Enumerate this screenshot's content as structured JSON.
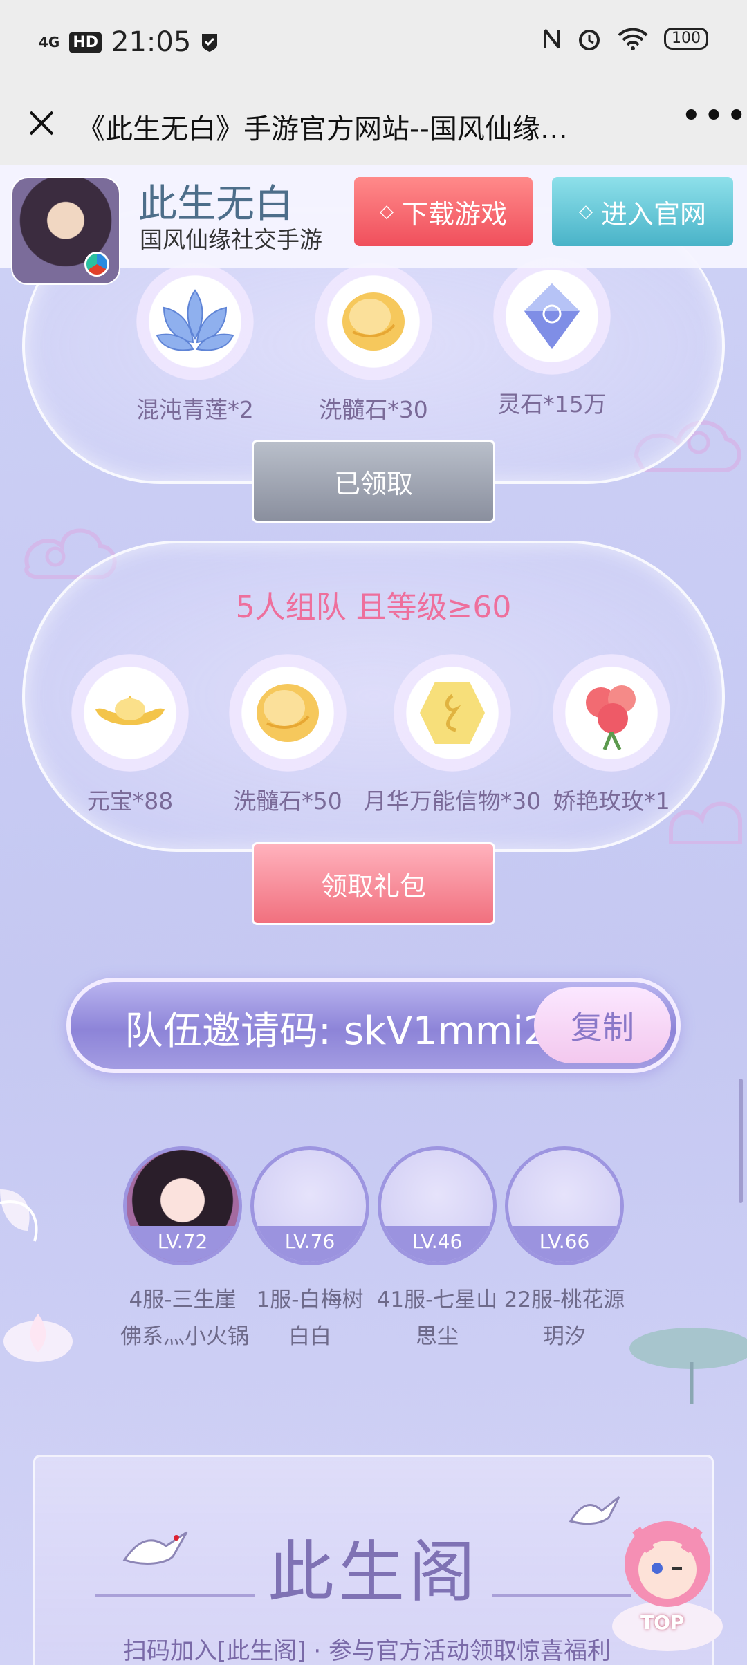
{
  "status_bar": {
    "network": "4G",
    "hd": "HD",
    "time": "21:05",
    "battery": "100"
  },
  "title_bar": {
    "title": "《此生无白》手游官方网站--国风仙缘…"
  },
  "app_banner": {
    "name": "此生无白",
    "subtitle": "国风仙缘社交手游",
    "download_label": "下载游戏",
    "official_label": "进入官网",
    "download_color": "#f04f5c",
    "official_color": "#49b3c8"
  },
  "panel1": {
    "items": [
      {
        "label": "混沌青莲*2",
        "icon": "lotus-icon"
      },
      {
        "label": "洗髓石*30",
        "icon": "gold-stone-icon"
      },
      {
        "label": "灵石*15万",
        "icon": "crystal-icon"
      }
    ],
    "button_label": "已领取"
  },
  "panel2": {
    "title": "5人组队 且等级≥60",
    "items": [
      {
        "label": "元宝*88",
        "icon": "gold-ingot-icon"
      },
      {
        "label": "洗髓石*50",
        "icon": "gold-stone-icon"
      },
      {
        "label": "月华万能信物*30",
        "icon": "token-icon"
      },
      {
        "label": "娇艳玫玫*1",
        "icon": "rose-icon"
      }
    ],
    "button_label": "领取礼包"
  },
  "invite": {
    "label": "队伍邀请码:",
    "code": "skV1mmi2",
    "copy_label": "复制"
  },
  "team": [
    {
      "level": "LV.72",
      "server": "4服-三生崖",
      "name": "佛系灬小火锅"
    },
    {
      "level": "LV.76",
      "server": "1服-白梅树",
      "name": "白白"
    },
    {
      "level": "LV.46",
      "server": "41服-七星山",
      "name": "思尘"
    },
    {
      "level": "LV.66",
      "server": "22服-桃花源",
      "name": "玥汐"
    }
  ],
  "footer": {
    "title": "此生阁",
    "description": "扫码加入[此生阁] · 参与官方活动领取惊喜福利",
    "top_label": "TOP"
  }
}
